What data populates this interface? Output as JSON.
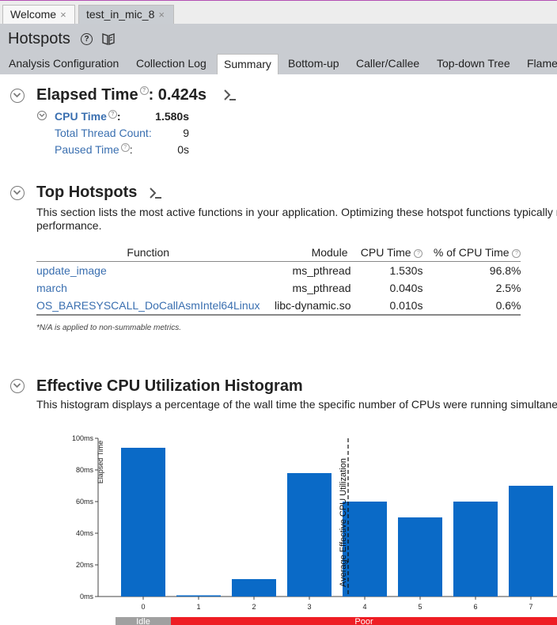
{
  "doc_tabs": [
    {
      "label": "Welcome",
      "close": "×"
    },
    {
      "label": "test_in_mic_8",
      "close": "×"
    }
  ],
  "header": {
    "title": "Hotspots"
  },
  "view_tabs": [
    {
      "label": "Analysis Configuration",
      "active": false
    },
    {
      "label": "Collection Log",
      "active": false
    },
    {
      "label": "Summary",
      "active": true
    },
    {
      "label": "Bottom-up",
      "active": false
    },
    {
      "label": "Caller/Callee",
      "active": false
    },
    {
      "label": "Top-down Tree",
      "active": false
    },
    {
      "label": "Flame",
      "active": false
    }
  ],
  "elapsed": {
    "title_prefix": "Elapsed Time",
    "title_suffix": ": 0.424s",
    "metrics": [
      {
        "label": "CPU Time",
        "value": "1.580s"
      },
      {
        "label": "Total Thread Count:",
        "value": "9"
      },
      {
        "label": "Paused Time",
        "value": "0s"
      }
    ]
  },
  "hotspots": {
    "title": "Top Hotspots",
    "description_line1": "This section lists the most active functions in your application. Optimizing these hotspot functions typically res",
    "description_line2": "performance.",
    "columns": [
      "Function",
      "Module",
      "CPU Time",
      "% of CPU Time"
    ],
    "rows": [
      {
        "function": "update_image",
        "module": "ms_pthread",
        "cpu_time": "1.530s",
        "pct": "96.8%"
      },
      {
        "function": "march",
        "module": "ms_pthread",
        "cpu_time": "0.040s",
        "pct": "2.5%"
      },
      {
        "function": "OS_BARESYSCALL_DoCallAsmIntel64Linux",
        "module": "libc-dynamic.so",
        "cpu_time": "0.010s",
        "pct": "0.6%"
      }
    ],
    "note": "*N/A is applied to non-summable metrics."
  },
  "histogram": {
    "title": "Effective CPU Utilization Histogram",
    "description": "This histogram displays a percentage of the wall time the specific number of CPUs were running simultaneou"
  },
  "chart_data": {
    "type": "bar",
    "categories": [
      "0",
      "1",
      "2",
      "3",
      "4",
      "5",
      "6",
      "7"
    ],
    "values": [
      94,
      0.5,
      11,
      78,
      60,
      50,
      60,
      70
    ],
    "ylabel": "Elapsed Time",
    "yticks": [
      "0ms",
      "20ms",
      "40ms",
      "60ms",
      "80ms",
      "100ms"
    ],
    "ylim": [
      0,
      100
    ],
    "average_marker": {
      "x": 3.7,
      "label": "Average Effective CPU Utilization"
    },
    "bands": [
      {
        "label": "Idle",
        "from": -0.5,
        "to": 0.5,
        "color": "#a0a0a0"
      },
      {
        "label": "Poor",
        "from": 0.5,
        "to": 7.5,
        "color": "#ee1d24"
      }
    ],
    "bar_color": "#0a6ac7",
    "grid": false
  }
}
